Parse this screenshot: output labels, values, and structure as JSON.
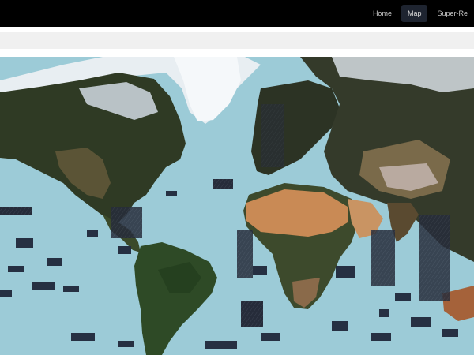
{
  "nav": {
    "items": [
      {
        "label": "Home",
        "active": false
      },
      {
        "label": "Map",
        "active": true
      },
      {
        "label": "Super-Re",
        "active": false
      }
    ]
  },
  "colors": {
    "ocean": "#9ccbd7",
    "header": "#000000",
    "toolbar": "#f0f0f0",
    "land_dark": "#2f3a24",
    "desert": "#c98a55",
    "ice": "#e8eef2"
  }
}
